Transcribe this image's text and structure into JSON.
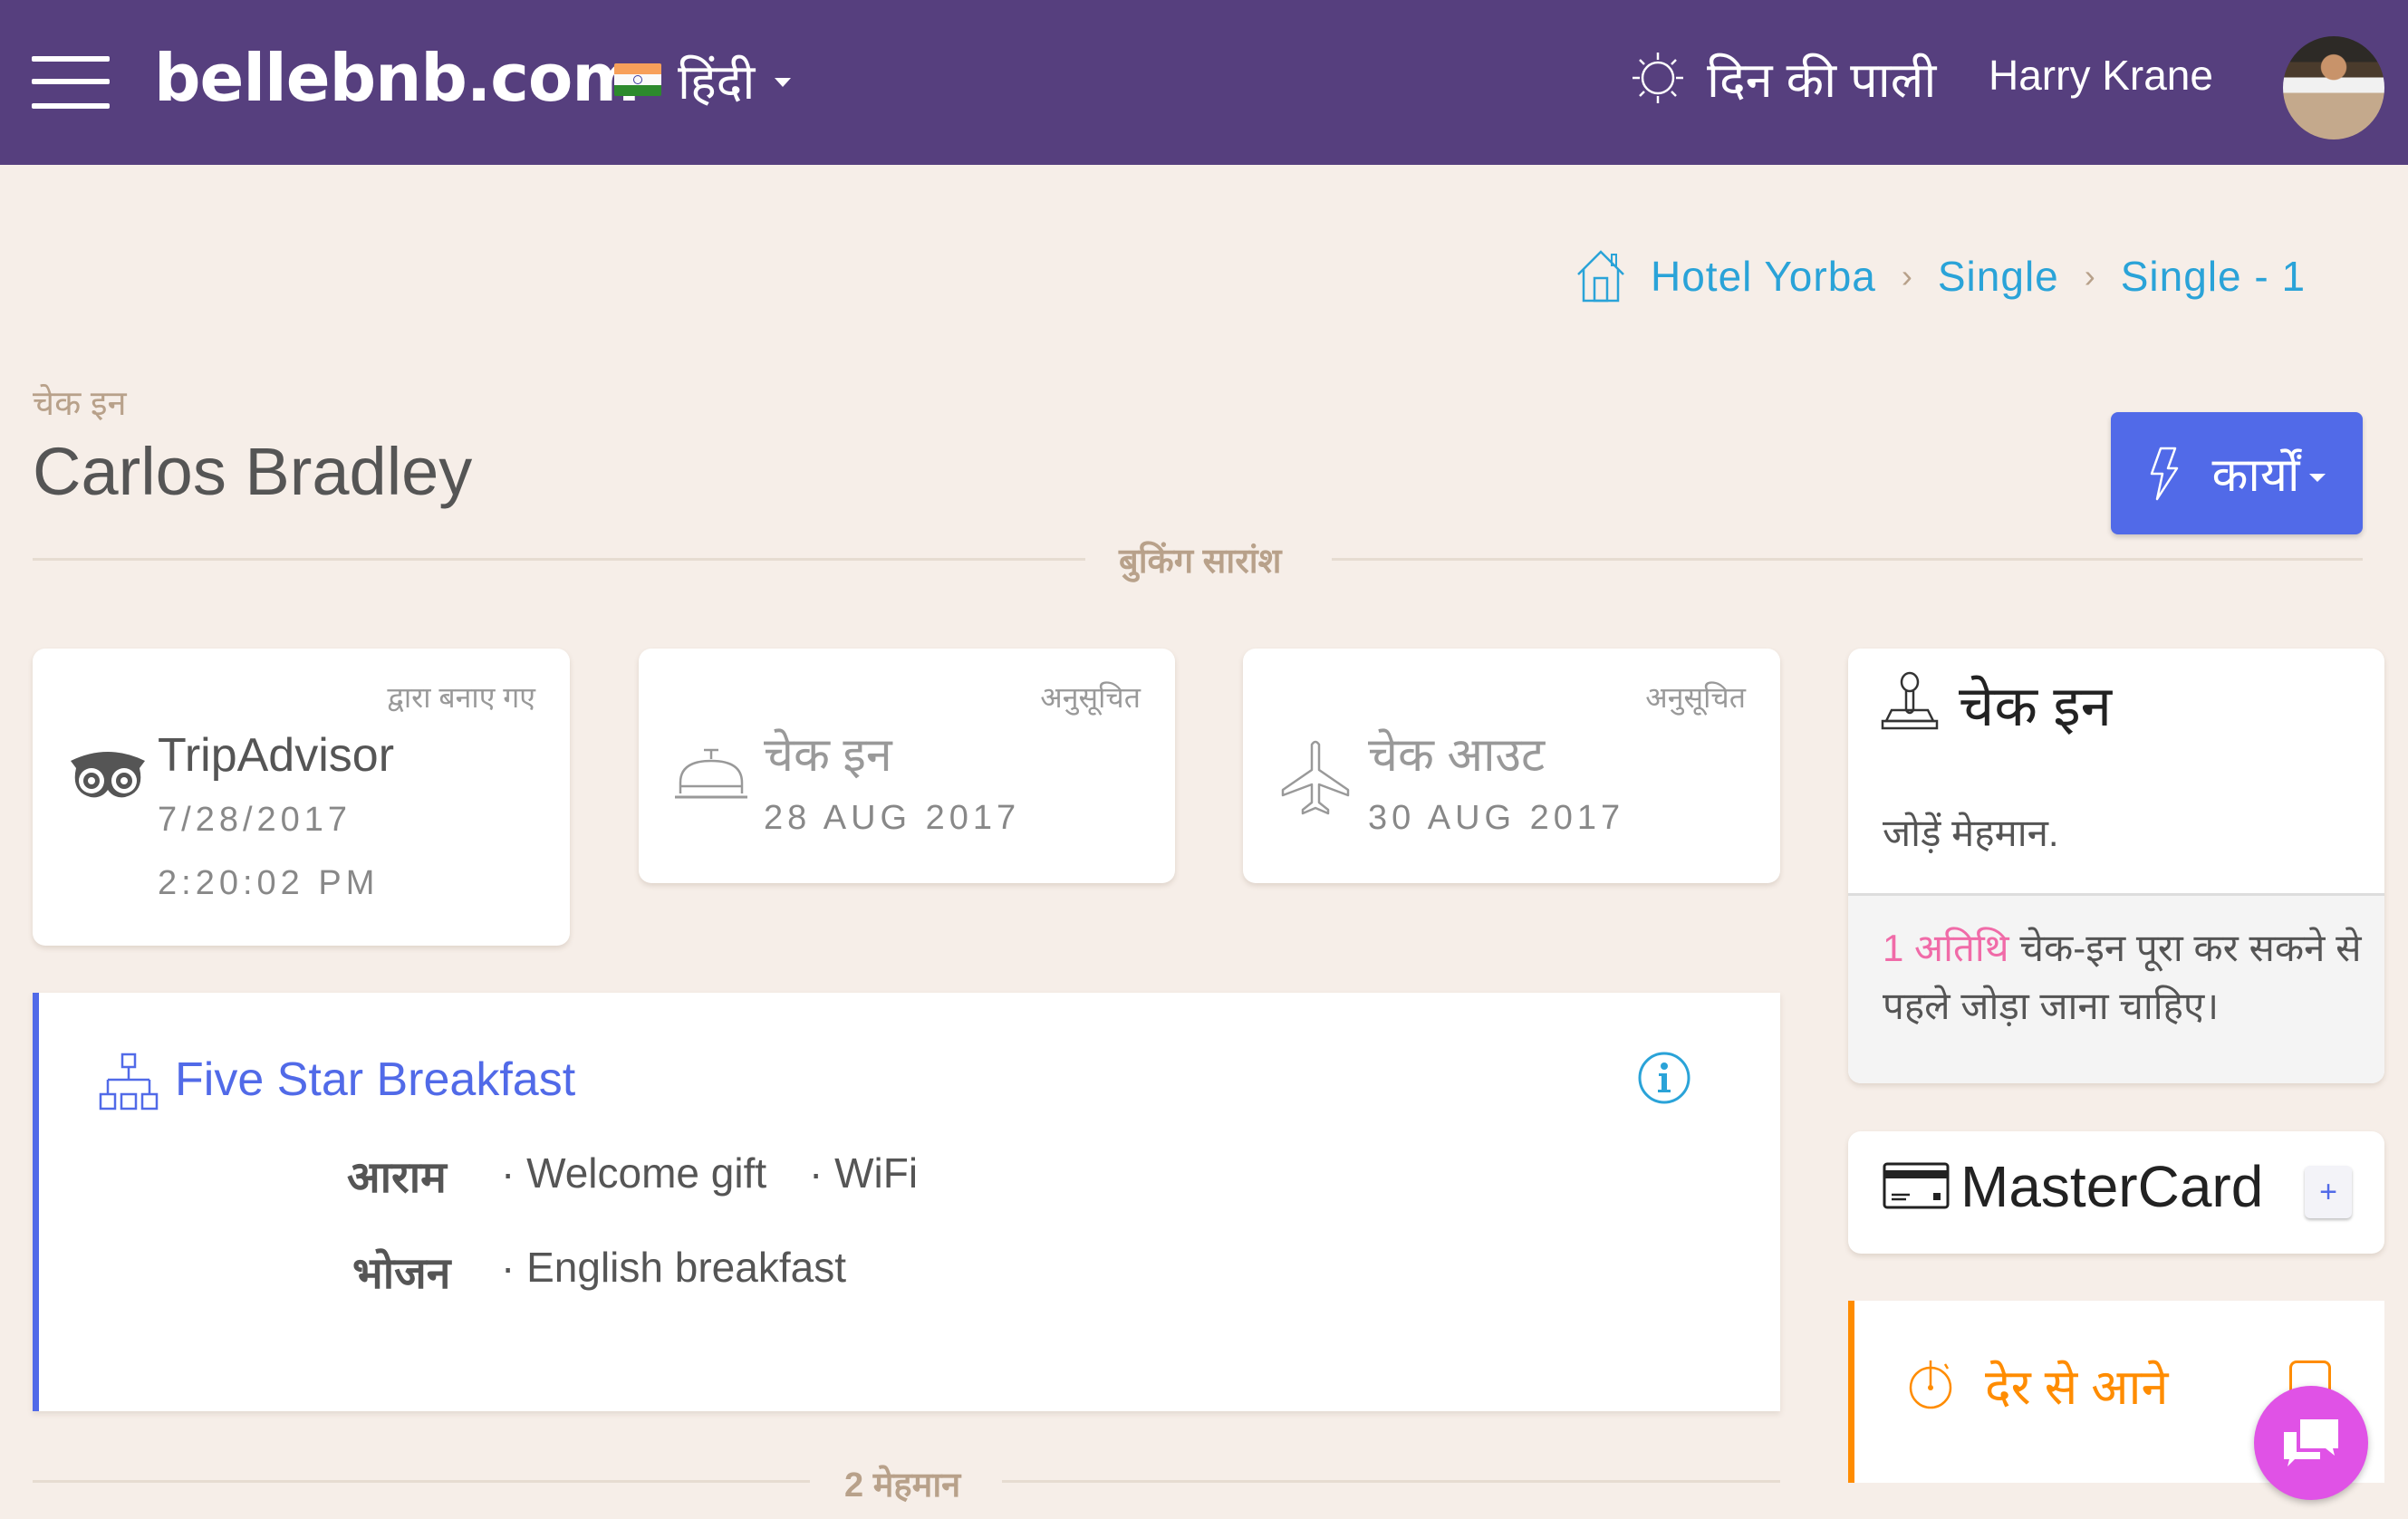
{
  "header": {
    "logo": "bellebnb.com",
    "language": "हिंदी",
    "shift": "दिन की पाली",
    "user_name": "Harry Krane"
  },
  "breadcrumb": {
    "items": [
      "Hotel Yorba",
      "Single",
      "Single - 1"
    ],
    "separator": "›"
  },
  "page": {
    "subtitle": "चेक इन",
    "title": "Carlos Bradley",
    "actions_label": "कार्यों",
    "booking_summary_label": "बुकिंग सारांश",
    "guests_label": "2 मेहमान"
  },
  "summary_cards": [
    {
      "label": "द्वारा बनाए गए",
      "title": "TripAdvisor",
      "line1": "7/28/2017",
      "line2": "2:20:02 PM",
      "icon": "tripadvisor-owl-icon"
    },
    {
      "label": "अनुसूचित",
      "title": "चेक इन",
      "line1": "28 AUG 2017",
      "icon": "reception-bell-icon"
    },
    {
      "label": "अनुसूचित",
      "title": "चेक आउट",
      "line1": "30 AUG 2017",
      "icon": "airplane-icon"
    }
  ],
  "package": {
    "name": "Five Star Breakfast",
    "amenities_label": "आराम",
    "amenities": [
      "Welcome gift",
      "WiFi"
    ],
    "meals_label": "भोजन",
    "meals": [
      "English breakfast"
    ]
  },
  "checkin_panel": {
    "title": "चेक इन",
    "body": "जोड़ें मेहमान.",
    "warning_count": "1 अतिथि",
    "warning_text": " चेक-इन पूरा कर सकने से पहले जोड़ा जाना चाहिए।"
  },
  "payment_panel": {
    "card_type": "MasterCard",
    "add_label": "+"
  },
  "late_panel": {
    "title": "देर से आने"
  },
  "colors": {
    "header": "#563f7e",
    "primary": "#516ae8",
    "link": "#2aa3d8",
    "warning": "#ff8c00",
    "accent_pink": "#f06ba8",
    "chat": "#e052e6",
    "background": "#f6eee8"
  }
}
